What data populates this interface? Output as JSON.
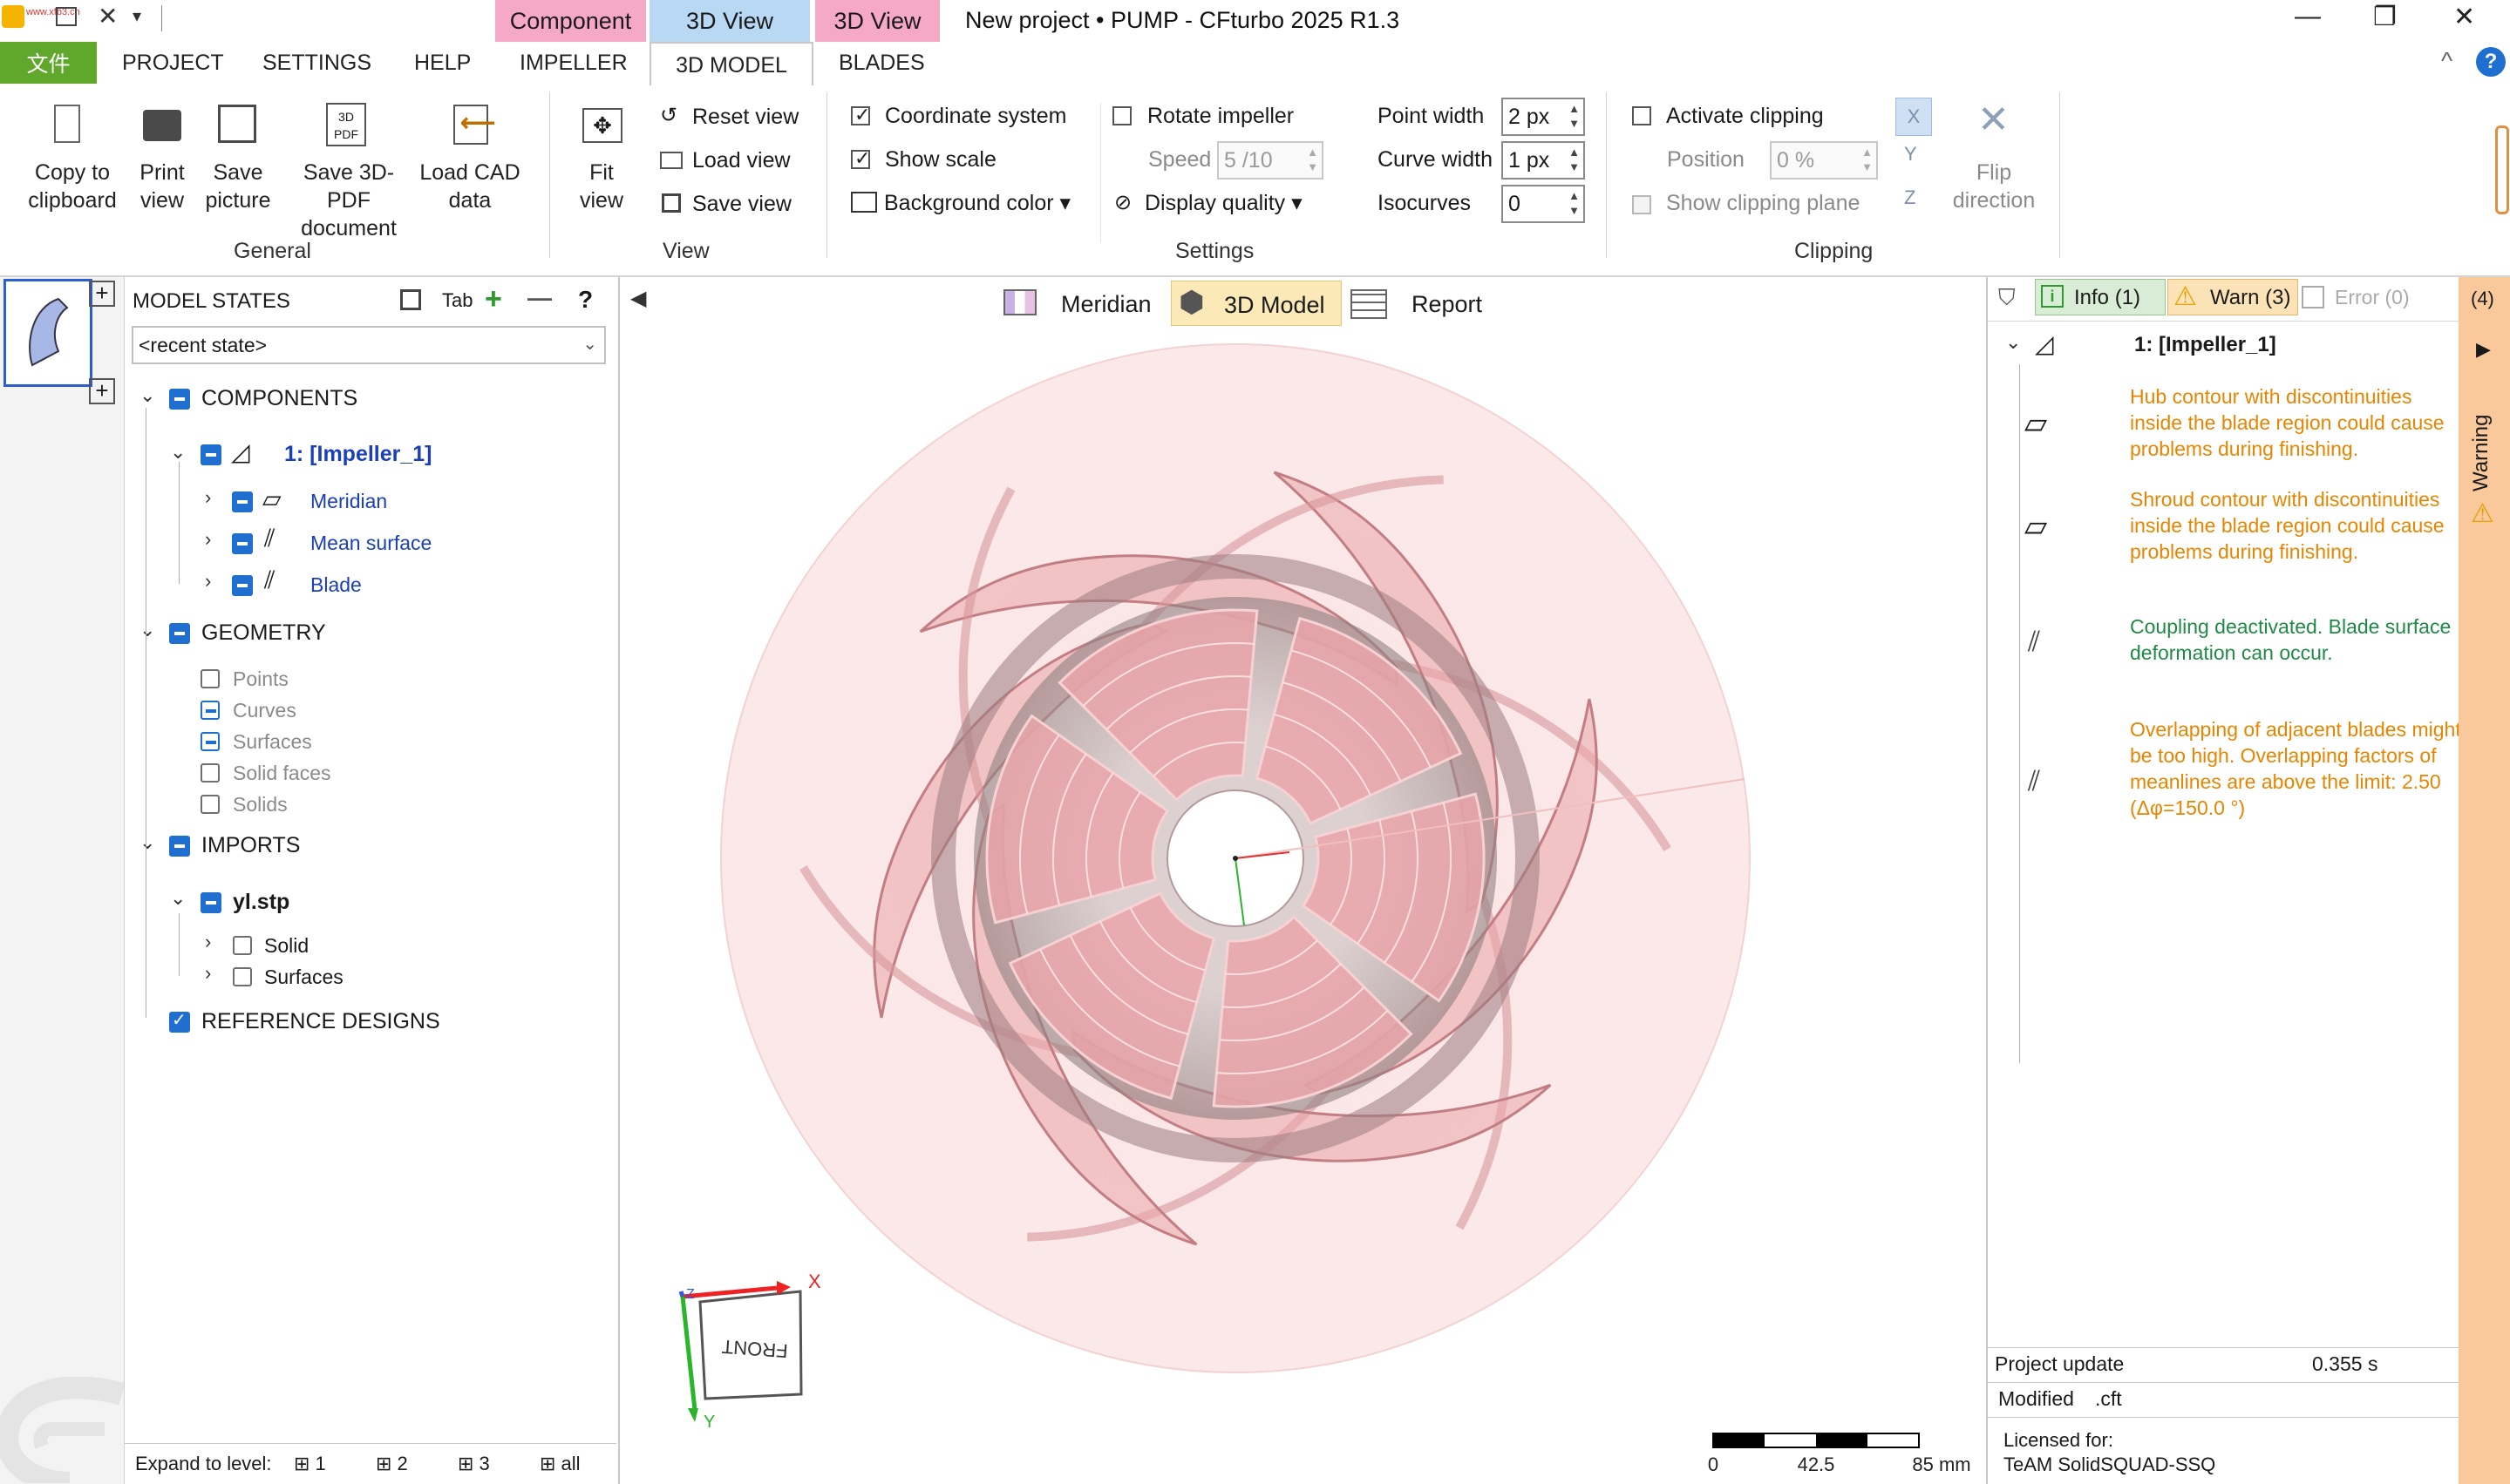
{
  "window": {
    "title": "New project • PUMP - CFturbo 2025 R1.3",
    "quick_access_text": "www.xfb3.cn",
    "controls": {
      "minimize": "—",
      "restore": "❐",
      "close": "✕"
    }
  },
  "context_tabs": [
    {
      "label": "Component",
      "color": "#f6a9c6"
    },
    {
      "label": "3D View",
      "color": "#b8d8f4"
    },
    {
      "label": "3D View",
      "color": "#f6a9c6"
    }
  ],
  "menu": {
    "file": "文件",
    "items": [
      "PROJECT",
      "SETTINGS",
      "HELP",
      "IMPELLER",
      "3D MODEL",
      "BLADES"
    ],
    "active": "3D MODEL",
    "collapse": "^",
    "help": "?"
  },
  "ribbon": {
    "general": {
      "label": "General",
      "buttons": [
        {
          "line1": "Copy to",
          "line2": "clipboard"
        },
        {
          "line1": "Print",
          "line2": "view"
        },
        {
          "line1": "Save",
          "line2": "picture"
        },
        {
          "line1": "Save 3D-PDF",
          "line2": "document"
        },
        {
          "line1": "Load CAD",
          "line2": "data"
        }
      ],
      "pdf_icon_text": "3D PDF"
    },
    "view": {
      "label": "View",
      "fit": {
        "line1": "Fit",
        "line2": "view"
      },
      "reset": "Reset view",
      "load": "Load view",
      "save": "Save view"
    },
    "settings": {
      "label": "Settings",
      "coordinate_system": {
        "label": "Coordinate system",
        "checked": true
      },
      "show_scale": {
        "label": "Show scale",
        "checked": true
      },
      "background_color": "Background color ▾",
      "rotate_impeller": {
        "label": "Rotate impeller",
        "checked": false
      },
      "speed_label": "Speed",
      "speed_value": "5 /10",
      "display_quality": "Display quality ▾",
      "point_width_label": "Point width",
      "point_width": "2 px",
      "curve_width_label": "Curve width",
      "curve_width": "1 px",
      "isocurves_label": "Isocurves",
      "isocurves": "0"
    },
    "clipping": {
      "label": "Clipping",
      "activate": {
        "label": "Activate clipping",
        "checked": false
      },
      "position_label": "Position",
      "position_value": "0 %",
      "show_plane": {
        "label": "Show clipping plane",
        "checked": false
      },
      "flip": {
        "line1": "Flip",
        "line2": "direction"
      },
      "axes": [
        "X",
        "Y",
        "Z"
      ]
    }
  },
  "model_states": {
    "title": "MODEL STATES",
    "tab_label": "Tab",
    "add": "+",
    "remove": "—",
    "help": "?",
    "selected": "<recent state>"
  },
  "tree": {
    "components": "COMPONENTS",
    "impeller": "1: [Impeller_1]",
    "meridian": "Meridian",
    "mean_surface": "Mean surface",
    "blade": "Blade",
    "geometry": "GEOMETRY",
    "points": "Points",
    "curves": "Curves",
    "surfaces": "Surfaces",
    "solid_faces": "Solid faces",
    "solids": "Solids",
    "imports": "IMPORTS",
    "yl": "yl.stp",
    "solid": "Solid",
    "imp_surfaces": "Surfaces",
    "reference": "REFERENCE DESIGNS"
  },
  "expand": {
    "label": "Expand to level:",
    "levels": [
      "1",
      "2",
      "3",
      "all"
    ]
  },
  "viewport": {
    "collapse_arrow": "◀",
    "tabs": [
      "Meridian",
      "3D Model",
      "Report"
    ],
    "active_tab": "3D Model",
    "cube_label": "FRONT",
    "axis_x": "X",
    "axis_y": "Y",
    "axis_z": "Z",
    "scale": {
      "labels": [
        "0",
        "42.5",
        "85 mm"
      ]
    },
    "model_color": "#e9a5a9"
  },
  "messages": {
    "info_tab": "Info (1)",
    "warn_tab": "Warn (3)",
    "error_tab": "Error (0)",
    "group": "1: [Impeller_1]",
    "items": [
      {
        "type": "warn",
        "text": "Hub contour with discontinuities inside the blade region could cause problems during finishing."
      },
      {
        "type": "warn",
        "text": "Shroud contour with discontinuities inside the blade region could cause problems during finishing."
      },
      {
        "type": "info",
        "text": "Coupling deactivated. Blade surface deformation can occur."
      },
      {
        "type": "warn",
        "text": "Overlapping of adjacent blades might be too high. Overlapping factors of meanlines are above the limit: 2.50 (Δφ=150.0 °)"
      }
    ],
    "project_update_label": "Project update",
    "project_update_value": "0.355 s",
    "modified_label": "Modified",
    "modified_value": ".cft",
    "licensed_label": "Licensed for:",
    "licensed_value": "TeAM SolidSQUAD-SSQ"
  },
  "side_strip": {
    "count": "(4)",
    "play": "▶",
    "label": "Warning"
  },
  "colors": {
    "file_green": "#5fa82c",
    "context_pink": "#f6a9c6",
    "context_blue": "#b8d8f4",
    "warn_orange": "#e78500",
    "info_green": "#1f8a46",
    "link_blue": "#1a3fb8"
  }
}
